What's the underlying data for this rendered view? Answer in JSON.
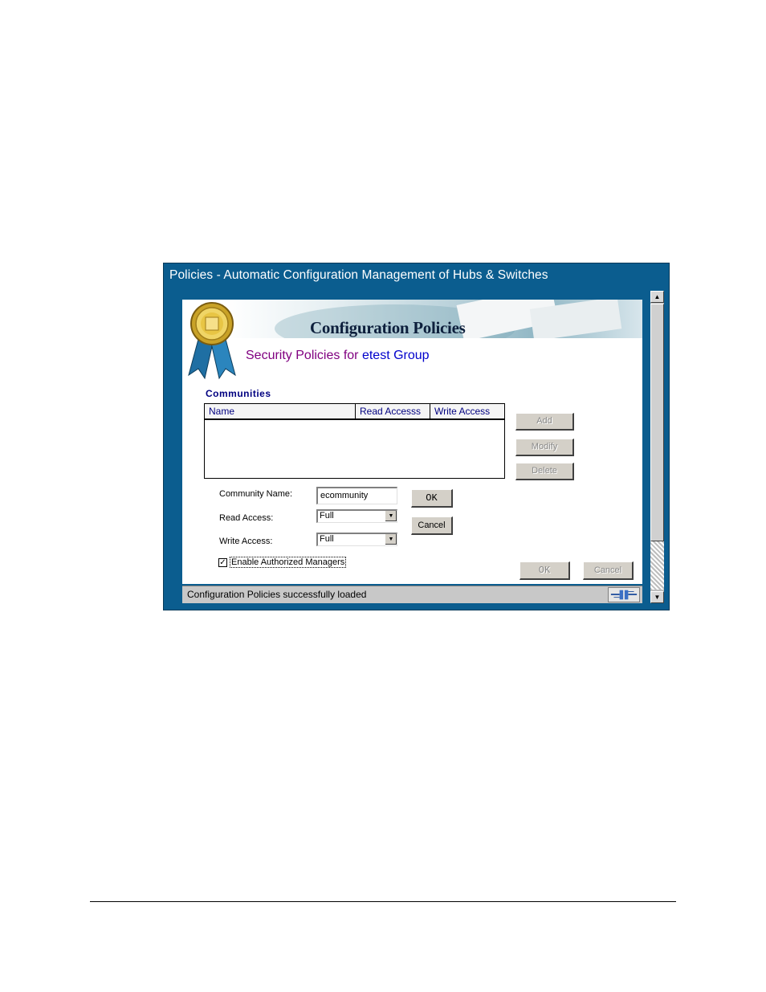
{
  "window": {
    "title": "Policies - Automatic Configuration Management of Hubs & Switches"
  },
  "banner": {
    "title": "Configuration Policies",
    "subtitle_prefix": "Security Policies for",
    "subtitle_group": "etest Group"
  },
  "communities": {
    "label": "Communities",
    "columns": [
      "Name",
      "Read Accesss",
      "Write Access"
    ],
    "rows": [],
    "buttons": {
      "add": "Add",
      "modify": "Modify",
      "delete": "Delete"
    }
  },
  "form": {
    "community_name_label": "Community Name:",
    "community_name_value": "ecommunity",
    "read_access_label": "Read Access:",
    "read_access_value": "Full",
    "write_access_label": "Write Access:",
    "write_access_value": "Full",
    "ok_label": "OK",
    "cancel_label": "Cancel"
  },
  "authorized_managers": {
    "label": "Enable Authorized Managers",
    "checked": true
  },
  "dialog_buttons": {
    "ok": "OK",
    "cancel": "Cancel"
  },
  "status": {
    "text": "Configuration Policies successfully loaded"
  },
  "colors": {
    "window_blue": "#0b5d8f",
    "subtitle_purple": "#800080",
    "subtitle_blue": "#0000cc",
    "label_navy": "#000080"
  },
  "icons": [
    "award-ribbon-icon",
    "dropdown-arrow-icon",
    "checkmark-icon",
    "scroll-up-icon",
    "scroll-down-icon",
    "network-connection-icon"
  ]
}
